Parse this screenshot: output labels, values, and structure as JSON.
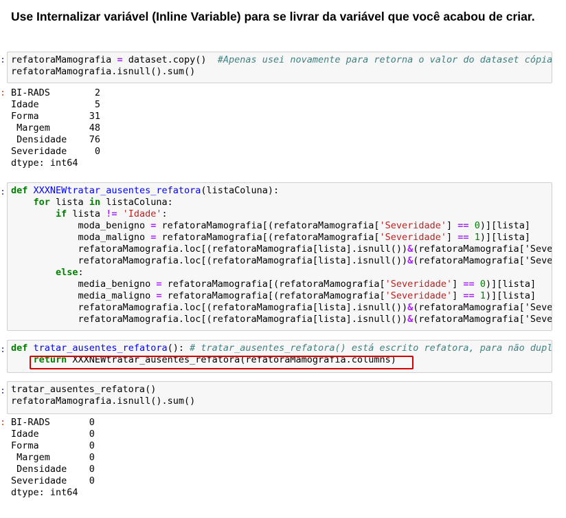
{
  "heading": "Use Internalizar variável (Inline Variable) para se livrar da variável que você acabou de criar.",
  "prompt_in": ":",
  "prompt_out": ":",
  "cell1": {
    "line1": {
      "a": "refatoraMamografia ",
      "b": "=",
      "c": " dataset.copy()  ",
      "comment": "#Apenas usei novamente para retorna o valor do dataset cópia"
    },
    "line2": "refatoraMamografia.isnull().sum()"
  },
  "output1": "BI-RADS        2\nIdade          5\nForma         31\n Margem       48\n Densidade    76\nSeveridade     0\ndtype: int64",
  "cell2": {
    "def_kw": "def",
    "fname": "XXXNEWtratar_ausentes_refatora",
    "sig": "(listaColuna):",
    "for_kw": "for",
    "for_var": " lista ",
    "in_kw": "in",
    "for_rest": " listaColuna:",
    "if_kw": "if",
    "if_a": " lista ",
    "ne": "!=",
    "idade": "'Idade'",
    "if_end": ":",
    "moda_b_a": "moda_benigno ",
    "moda_m_a": "moda_maligno ",
    "media_b_a": "media_benigno ",
    "media_m_a": "media_maligno ",
    "eq": "=",
    "sel_a": " refatoraMamografia[(refatoraMamografia[",
    "sev": "'Severidade'",
    "deq": "==",
    "zero": "0",
    "one": "1",
    "sel_tail": ")][lista]",
    "loc_line": "refatoraMamografia.loc[(refatoraMamografia[lista].isnull())",
    "amp": "&",
    "loc_tail": "(refatoraMamografia['Severidade']",
    "else_kw": "else",
    "colon": ":"
  },
  "cell3": {
    "def_kw": "def",
    "fname": "tratar_ausentes_refatora",
    "sig": "(): ",
    "comment": "# tratar_ausentes_refatora() está escrito refatora, para não duplicar",
    "return_kw": "return",
    "return_rest": " XXXNEWtratar_ausentes_refatora(refatoraMamografia.columns)"
  },
  "cell4": {
    "line1": "tratar_ausentes_refatora()",
    "line2": "refatoraMamografia.isnull().sum()"
  },
  "output2": "BI-RADS       0\nIdade         0\nForma         0\n Margem       0\n Densidade    0\nSeveridade    0\ndtype: int64"
}
